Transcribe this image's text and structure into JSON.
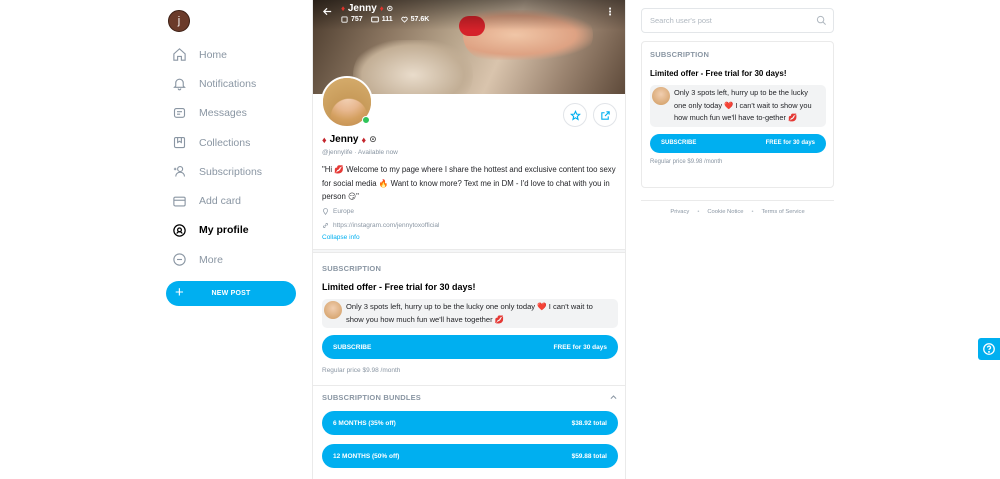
{
  "sidebar": {
    "avatar_initial": "j",
    "items": [
      {
        "label": "Home",
        "icon": "home-icon"
      },
      {
        "label": "Notifications",
        "icon": "bell-icon"
      },
      {
        "label": "Messages",
        "icon": "message-icon"
      },
      {
        "label": "Collections",
        "icon": "bookmark-icon"
      },
      {
        "label": "Subscriptions",
        "icon": "subscriptions-icon"
      },
      {
        "label": "Add card",
        "icon": "card-icon"
      },
      {
        "label": "My profile",
        "icon": "profile-icon"
      },
      {
        "label": "More",
        "icon": "more-icon"
      }
    ],
    "active_item": "My profile",
    "new_post_label": "NEW POST"
  },
  "profile": {
    "cover_name": "Jenny",
    "stats": {
      "photos": "757",
      "videos": "111",
      "likes": "57.6K"
    },
    "name": "Jenny",
    "handle": "@jennylife",
    "status": "Available now",
    "bio": "\"Hi 💋 Welcome to my page where I share the hottest and exclusive content too sexy for social media 🔥 Want to know more? Text me in DM - I'd love to chat with you in person 😏\"",
    "location": "Europe",
    "link": "https://instagram.com/jennytoxofficial",
    "collapse_label": "Collapse info"
  },
  "subscription": {
    "section_title": "SUBSCRIPTION",
    "offer_title": "Limited offer - Free trial for 30 days!",
    "offer_message": "Only 3 spots left, hurry up to be the lucky one only today ❤️ I can't wait to show you how much fun we'll have together 💋",
    "subscribe_label": "SUBSCRIBE",
    "subscribe_value": "FREE for 30 days",
    "regular_price": "Regular price $9.98 /month"
  },
  "bundles": {
    "section_title": "SUBSCRIPTION BUNDLES",
    "items": [
      {
        "label": "6 MONTHS (35% off)",
        "price": "$38.92 total"
      },
      {
        "label": "12 MONTHS (50% off)",
        "price": "$59.88 total"
      }
    ]
  },
  "right": {
    "search_placeholder": "Search user's post",
    "subscription": {
      "section_title": "SUBSCRIPTION",
      "offer_title": "Limited offer - Free trial for 30 days!",
      "offer_message": "Only 3 spots left, hurry up to be the lucky one only today ❤️ I can't wait to show you how much fun we'll have to-gether 💋",
      "subscribe_label": "SUBSCRIBE",
      "subscribe_value": "FREE for 30 days",
      "regular_price": "Regular price $9.98 /month"
    },
    "footer": [
      "Privacy",
      "Cookie Notice",
      "Terms of Service"
    ]
  },
  "colors": {
    "accent": "#00aff0",
    "muted": "#8a96a3",
    "online": "#2ec45a"
  }
}
